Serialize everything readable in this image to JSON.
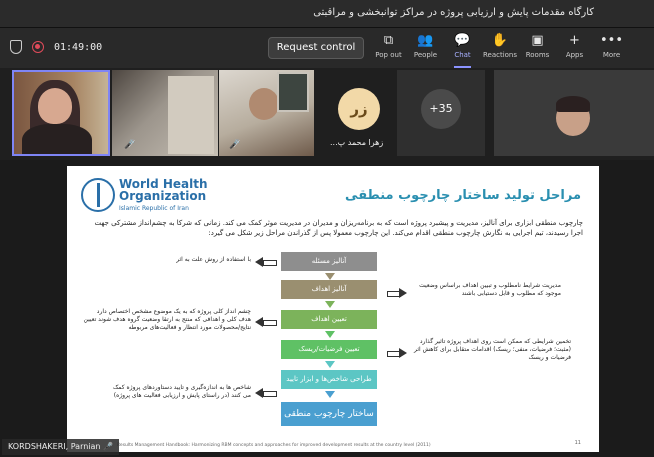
{
  "window": {
    "title": "کارگاه مقدمات پایش و ارزیابی پروژه در مراکز توانبخشی و مراقبتی"
  },
  "toolbar": {
    "timer": "01:49:00",
    "request_control": "Request control",
    "tools": [
      {
        "label": "Pop out",
        "icon": "pop-out-icon",
        "glyph": "⧉"
      },
      {
        "label": "People",
        "icon": "people-icon",
        "glyph": "👥"
      },
      {
        "label": "Chat",
        "icon": "chat-icon",
        "glyph": "💬"
      },
      {
        "label": "Reactions",
        "icon": "reactions-icon",
        "glyph": "✋"
      },
      {
        "label": "Rooms",
        "icon": "rooms-icon",
        "glyph": "▣"
      },
      {
        "label": "Apps",
        "icon": "apps-icon",
        "glyph": "+"
      },
      {
        "label": "More",
        "icon": "more-icon",
        "glyph": "•••"
      }
    ]
  },
  "participants": {
    "avatar_initials": "زر",
    "avatar_name": "زهرا محمد پ...",
    "overflow_count": "+35"
  },
  "slide": {
    "logo_line1": "World Health",
    "logo_line2": "Organization",
    "logo_sub": "Islamic Republic of Iran",
    "title": "مراحل تولید ساختار چارچوب منطقی",
    "intro": "چارچوب منطقی ابزاری برای آنالیز، مدیریت و پیشبرد پروژه است که به برنامه‌ریزان و مدیران در مدیریت موثر کمک می کند. زمانی که شرکا به چشم‌انداز مشترکی جهت اجرا رسیدند، تیم اجرایی به نگارش چارچوب منطقی اقدام می‌کند. این چارچوب معمولا پس از گذراندن مراحل زیر شکل می گیرد:",
    "steps": [
      "آنالیز مسئله",
      "آنالیز اهداف",
      "تعیین اهداف",
      "تعیین فرضیات/ریسک",
      "طراحی شاخص‌ها و ابزار تایید",
      "ساختار چارچوب منطقی"
    ],
    "left_notes": [
      "با استفاده از روش علت به اثر",
      "چشم انداز کلی پروژه که به یک موضوع مشخص اختصاص دارد هدف کلی و اهدافی که منتج به ارتقا وضعیت گروه هدف شوند تعیین نتایج/محصولات مورد انتظار و فعالیت‌های مربوطه",
      "شاخص ها به اندازه‌گیری و تایید دستاوردهای پروژه کمک می کنند (در راستای پایش و ارزیابی فعالیت های پروژه)"
    ],
    "right_notes": [
      "مدیریت شرایط نامطلوب و تبیین اهداف براساس وضعیت موجود که مطلوب و قابل دستیابی باشند",
      "تخمین شرایطی که ممکن است روی اهداف پروژه تاثیر گذارد (مثبت؛ فرضیات، منفی؛ ریسک) اقدامات متقابل برای کاهش اثر فرضیات و ریسک"
    ],
    "footer": "Results Management Handbook: Harmonizing RBM concepts and approaches for improved development results at the country level (2011)",
    "page_number": "11"
  },
  "presenter_tag": "KORDSHAKERI, Parnian",
  "colors": {
    "step_colors": [
      "#8e8e8e",
      "#9a8f70",
      "#7cb35b",
      "#5fc165",
      "#5cc6c4",
      "#4a9fd0"
    ],
    "accent": "#7f85f5"
  }
}
